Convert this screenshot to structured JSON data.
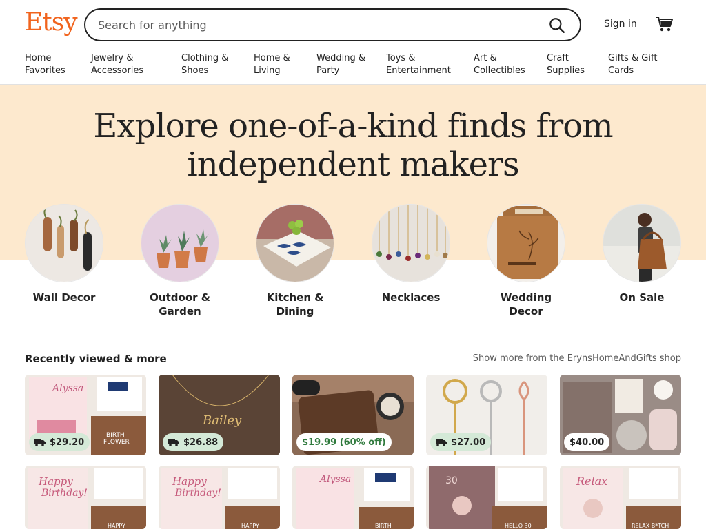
{
  "brand": {
    "logo": "Etsy",
    "accent": "#f1641e"
  },
  "search": {
    "placeholder": "Search for anything"
  },
  "header": {
    "signin": "Sign in"
  },
  "nav": [
    {
      "l1": "Home",
      "l2": "Favorites"
    },
    {
      "l1": "Jewelry &",
      "l2": "Accessories"
    },
    {
      "l1": "Clothing &",
      "l2": "Shoes"
    },
    {
      "l1": "Home &",
      "l2": "Living"
    },
    {
      "l1": "Wedding &",
      "l2": "Party"
    },
    {
      "l1": "Toys &",
      "l2": "Entertainment"
    },
    {
      "l1": "Art &",
      "l2": "Collectibles"
    },
    {
      "l1": "Craft",
      "l2": "Supplies"
    },
    {
      "l1": "Gifts & Gift",
      "l2": "Cards"
    }
  ],
  "hero": {
    "title": "Explore one-of-a-kind finds from independent makers",
    "bg": "#fde9ce"
  },
  "categories": [
    {
      "l1": "Wall Decor",
      "l2": ""
    },
    {
      "l1": "Outdoor &",
      "l2": "Garden"
    },
    {
      "l1": "Kitchen &",
      "l2": "Dining"
    },
    {
      "l1": "Necklaces",
      "l2": ""
    },
    {
      "l1": "Wedding",
      "l2": "Decor"
    },
    {
      "l1": "On Sale",
      "l2": ""
    }
  ],
  "recent": {
    "title": "Recently viewed & more",
    "more_prefix": "Show more from the",
    "shop": "ErynsHomeAndGifts",
    "more_suffix": "shop",
    "row1": [
      {
        "price": "$29.20",
        "badge": "delivery",
        "text": "BIRTH FLOWER"
      },
      {
        "price": "$26.88",
        "badge": "delivery",
        "text": ""
      },
      {
        "price": "$19.99 (60% off)",
        "badge": "sale",
        "text": ""
      },
      {
        "price": "$27.00",
        "badge": "delivery",
        "text": ""
      },
      {
        "price": "$40.00",
        "badge": "plain",
        "text": ""
      }
    ],
    "row2_text": [
      "HAPPY",
      "HAPPY",
      "BIRTH",
      "HELLO 30",
      "RELAX B*TCH"
    ]
  }
}
